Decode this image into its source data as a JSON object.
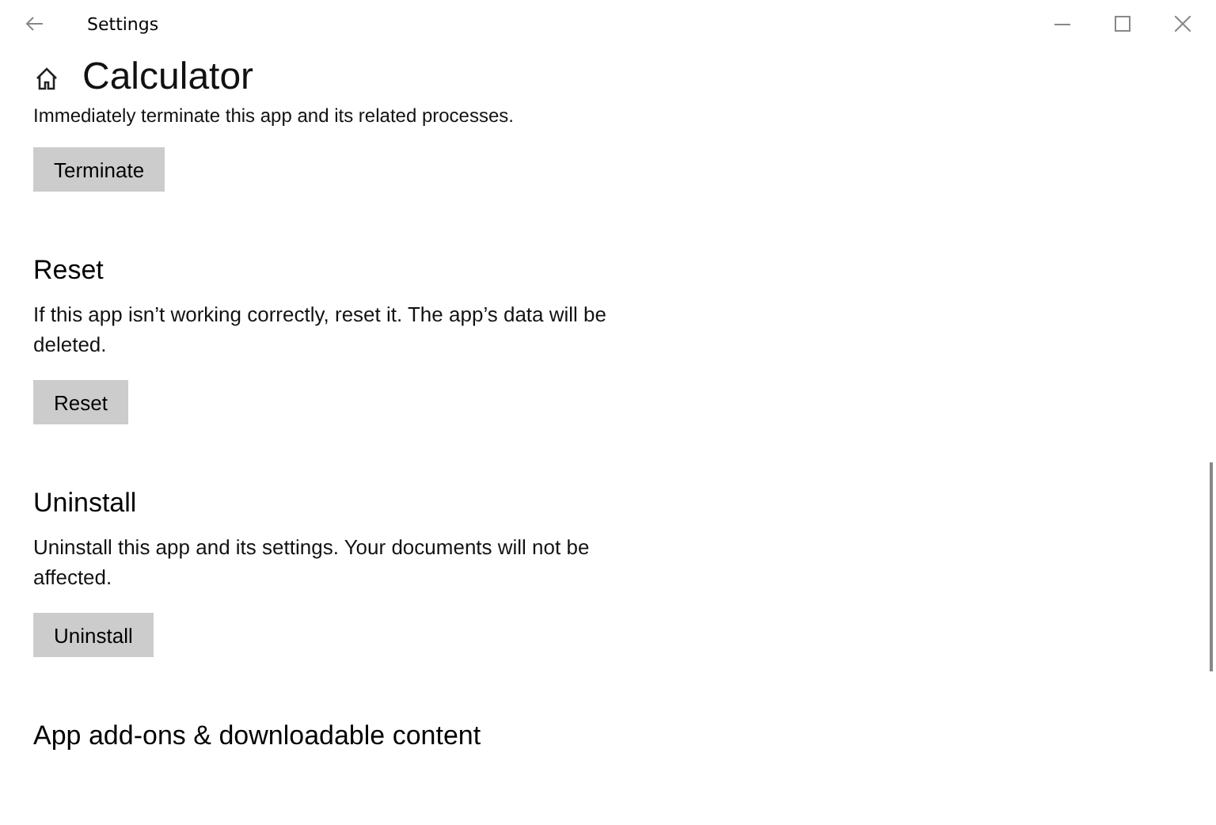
{
  "window": {
    "title": "Settings"
  },
  "page": {
    "title": "Calculator"
  },
  "sections": [
    {
      "description": "Immediately terminate this app and its related processes.",
      "button": "Terminate"
    },
    {
      "heading": "Reset",
      "description": "If this app isn’t working correctly, reset it. The app’s data will be deleted.",
      "button": "Reset"
    },
    {
      "heading": "Uninstall",
      "description": "Uninstall this app and its settings. Your documents will not be affected.",
      "button": "Uninstall"
    },
    {
      "heading": "App add-ons & downloadable content"
    }
  ]
}
